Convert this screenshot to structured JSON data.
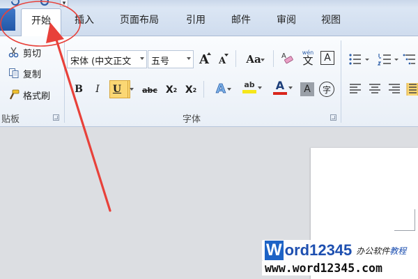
{
  "tabs": {
    "home": "开始",
    "insert": "插入",
    "page_layout": "页面布局",
    "references": "引用",
    "mailings": "邮件",
    "review": "审阅",
    "view": "视图"
  },
  "clipboard": {
    "label": "贴板",
    "cut": "剪切",
    "copy": "复制",
    "format_painter": "格式刷"
  },
  "font": {
    "label": "字体",
    "font_name": "宋体 (中文正文",
    "font_size": "五号",
    "grow": "A",
    "shrink": "A",
    "change_case": "Aa",
    "clear_format": "A",
    "phonetic": "文",
    "phonetic_top": "wén",
    "char_border": "A",
    "bold": "B",
    "italic": "I",
    "underline": "U",
    "strikethrough": "abc",
    "subscript": "X",
    "subscript_mark": "2",
    "superscript": "X",
    "superscript_mark": "2",
    "text_effects": "A",
    "highlight": "ab",
    "font_color": "A",
    "char_shading": "A",
    "enclose_char": "字"
  },
  "watermark": {
    "brand_w": "W",
    "brand_rest": "ord12345",
    "brand_cn_1": "办公软件",
    "brand_cn_2": "教程",
    "url": "www.word12345.com"
  },
  "colors": {
    "accent_blue": "#2b5fb0",
    "annotation_red": "#e8413a",
    "highlight_yellow": "#f6e71a",
    "font_color_red": "#d9261c",
    "selected_button": "#fbd774"
  }
}
